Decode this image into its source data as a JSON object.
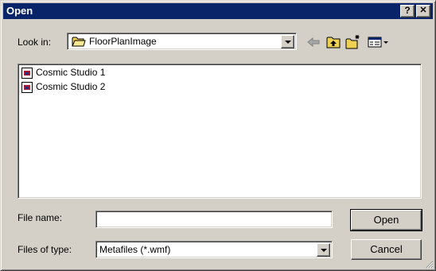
{
  "window": {
    "title": "Open",
    "help_glyph": "?",
    "close_glyph": "✕"
  },
  "look_in": {
    "label": "Look in:",
    "folder": "FloorPlanImage"
  },
  "toolbar": {
    "icons": [
      "back-arrow-icon",
      "up-folder-icon",
      "new-folder-icon",
      "view-menu-icon"
    ]
  },
  "files": [
    {
      "name": "Cosmic Studio 1",
      "icon": "metafile-icon"
    },
    {
      "name": "Cosmic Studio 2",
      "icon": "metafile-icon"
    }
  ],
  "file_name": {
    "label": "File name:",
    "value": ""
  },
  "file_type": {
    "label": "Files of type:",
    "value": "Metafiles (*.wmf)"
  },
  "buttons": {
    "open": "Open",
    "cancel": "Cancel"
  },
  "colors": {
    "title_bar": "#0a246a",
    "face": "#d4d0c8",
    "folder_yellow": "#f0d050"
  }
}
